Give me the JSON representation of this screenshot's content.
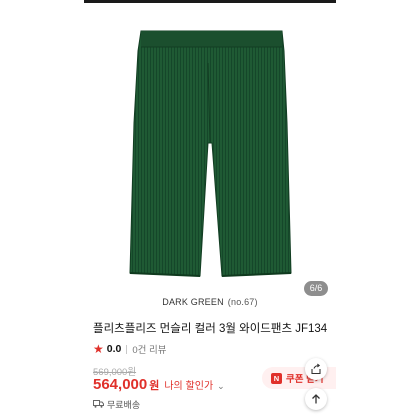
{
  "gallery": {
    "page_indicator": "6/6",
    "color_name": "DARK GREEN",
    "color_code": "(no.67)"
  },
  "product": {
    "title": "플리츠플리즈 먼슬리 컬러 3월 와이드팬츠 JF134",
    "rating_star": "★",
    "rating_score": "0.0",
    "review_count": "0건 리뷰",
    "original_price": "569,000원",
    "price": "564,000",
    "price_unit": "원",
    "my_discount_label": "나의 할인가",
    "discount_chevron": "⌄",
    "shipping_label": "무료배송"
  },
  "coupon": {
    "badge": "N",
    "label": "쿠폰 받기"
  },
  "colors": {
    "accent_red": "#e0302a",
    "pants_green": "#1f5a34",
    "pants_dark": "#123d22"
  },
  "icons": {
    "share": "share-icon",
    "scroll_top": "arrow-up-icon",
    "shipping": "truck-icon"
  }
}
